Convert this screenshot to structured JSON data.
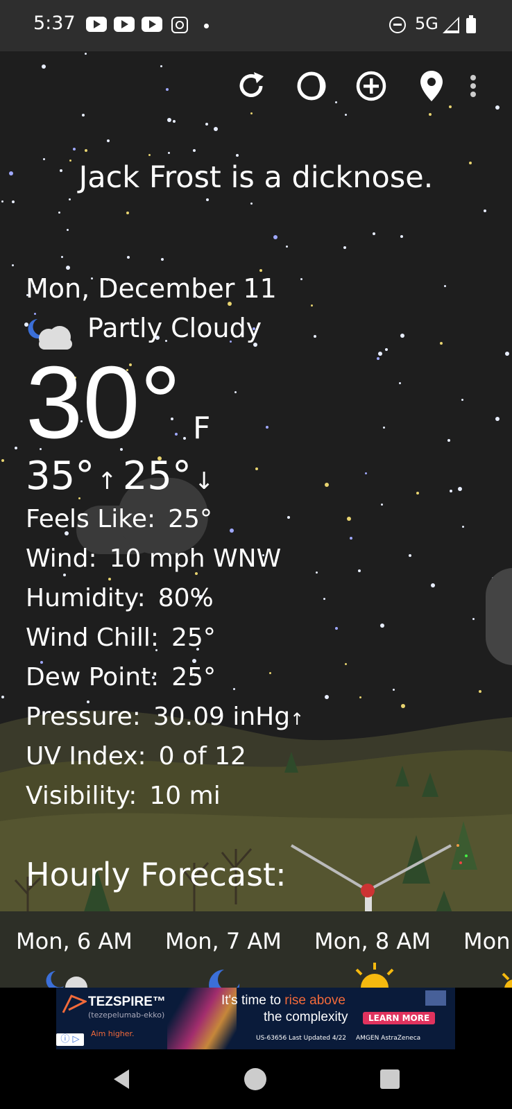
{
  "status_bar": {
    "time": "5:37",
    "network": "5G",
    "icons": [
      "youtube-icon",
      "youtube-icon",
      "youtube-icon",
      "instagram-icon",
      "notification-dot",
      "do-not-disturb-icon",
      "signal-icon",
      "battery-icon"
    ]
  },
  "toolbar": {
    "icons": [
      "refresh-icon",
      "theme-icon",
      "add-location-icon",
      "location-pin-icon",
      "more-vert-icon"
    ]
  },
  "headline": "Jack Frost is a dicknose.",
  "current": {
    "date": "Mon, December 11",
    "condition": "Partly Cloudy",
    "condition_icon": "partly-cloudy-night-icon",
    "temperature": "30°",
    "unit": "F",
    "high": "35°",
    "low": "25°",
    "details": [
      {
        "label": "Feels Like:",
        "value": "25°"
      },
      {
        "label": "Wind:",
        "value": "10 mph WNW"
      },
      {
        "label": "Humidity:",
        "value": "80%"
      },
      {
        "label": "Wind Chill:",
        "value": "25°"
      },
      {
        "label": "Dew Point:",
        "value": "25°"
      },
      {
        "label": "Pressure:",
        "value": "30.09 inHg"
      },
      {
        "label": "UV Index:",
        "value": "0 of 12"
      },
      {
        "label": "Visibility:",
        "value": "10 mi"
      }
    ]
  },
  "hourly": {
    "title": "Hourly Forecast:",
    "items": [
      {
        "time": "Mon, 6 AM",
        "icon": "partly-cloudy-night-icon"
      },
      {
        "time": "Mon, 7 AM",
        "icon": "moon-icon"
      },
      {
        "time": "Mon, 8 AM",
        "icon": "sun-icon"
      },
      {
        "time": "Mon",
        "icon": "sun-icon"
      }
    ]
  },
  "ad": {
    "brand": "TEZSPIRE™",
    "generic": "(tezepelumab-ekko)",
    "tagline": "Aim higher.",
    "headline_a": "It's time to ",
    "headline_b": "rise above",
    "headline_c": "the complexity",
    "cta": "LEARN MORE",
    "footer": "US-63656 Last Updated 4/22",
    "sponsors": "AMGEN  AstraZeneca"
  },
  "colors": {
    "sky": "#1e1e1e",
    "status_bar": "#2e2e2e",
    "text": "#ffffff",
    "ad_accent": "#f26a3a",
    "ad_cta": "#e0335e"
  }
}
